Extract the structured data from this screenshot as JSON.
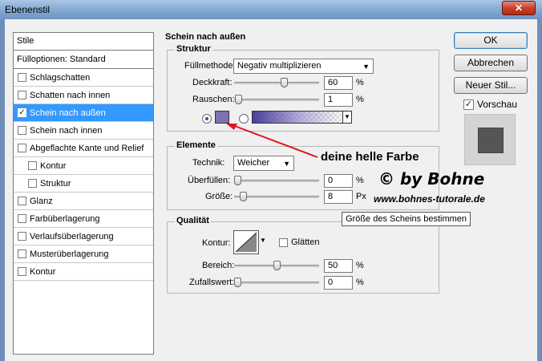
{
  "window": {
    "title": "Ebenenstil",
    "close_icon": "close-icon"
  },
  "sidebar": {
    "header": "Stile",
    "blending": "Fülloptionen: Standard",
    "items": [
      {
        "label": "Schlagschatten",
        "checked": false,
        "active": false,
        "sub": false
      },
      {
        "label": "Schatten nach innen",
        "checked": false,
        "active": false,
        "sub": false
      },
      {
        "label": "Schein nach außen",
        "checked": true,
        "active": true,
        "sub": false
      },
      {
        "label": "Schein nach innen",
        "checked": false,
        "active": false,
        "sub": false
      },
      {
        "label": "Abgeflachte Kante und Relief",
        "checked": false,
        "active": false,
        "sub": false
      },
      {
        "label": "Kontur",
        "checked": false,
        "active": false,
        "sub": true
      },
      {
        "label": "Struktur",
        "checked": false,
        "active": false,
        "sub": true
      },
      {
        "label": "Glanz",
        "checked": false,
        "active": false,
        "sub": false
      },
      {
        "label": "Farbüberlagerung",
        "checked": false,
        "active": false,
        "sub": false
      },
      {
        "label": "Verlaufsüberlagerung",
        "checked": false,
        "active": false,
        "sub": false
      },
      {
        "label": "Musterüberlagerung",
        "checked": false,
        "active": false,
        "sub": false
      },
      {
        "label": "Kontur",
        "checked": false,
        "active": false,
        "sub": false
      }
    ]
  },
  "main": {
    "title": "Schein nach außen",
    "struktur": {
      "label": "Struktur",
      "blend_mode_label": "Füllmethode:",
      "blend_mode_value": "Negativ multiplizieren",
      "opacity_label": "Deckkraft:",
      "opacity_value": "60",
      "opacity_unit": "%",
      "opacity_level": 0.6,
      "noise_label": "Rauschen:",
      "noise_value": "1",
      "noise_unit": "%",
      "noise_level": 0.01,
      "color_swatch": "#7b74b0"
    },
    "elemente": {
      "label": "Elemente",
      "technique_label": "Technik:",
      "technique_value": "Weicher",
      "spread_label": "Überfüllen:",
      "spread_value": "0",
      "spread_unit": "%",
      "size_label": "Größe:",
      "size_value": "8",
      "size_unit": "Px"
    },
    "qualitaet": {
      "label": "Qualität",
      "contour_label": "Kontur:",
      "smooth_label": "Glätten",
      "range_label": "Bereich:",
      "range_value": "50",
      "range_unit": "%",
      "jitter_label": "Zufallswert:",
      "jitter_value": "0",
      "jitter_unit": "%"
    }
  },
  "buttons": {
    "ok": "OK",
    "cancel": "Abbrechen",
    "new_style": "Neuer Stil...",
    "preview": "Vorschau"
  },
  "annotations": {
    "color_note": "deine helle Farbe",
    "credit": "© by Bohne",
    "website": "www.bohnes-tutorale.de",
    "tooltip": "Größe des Scheins bestimmen"
  },
  "colors": {
    "accent": "#3399ff",
    "arrow": "#e0141c"
  }
}
